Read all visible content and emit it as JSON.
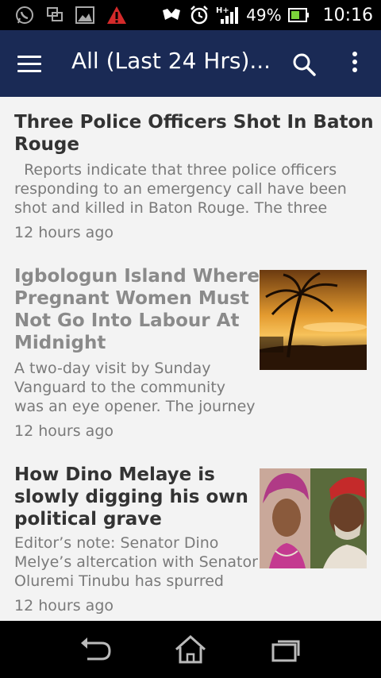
{
  "status_bar": {
    "battery": "49%",
    "time": "10:16",
    "icons": [
      "whatsapp-icon",
      "screenshot-icon",
      "gallery-icon",
      "warning-icon",
      "headset-icon",
      "alarm-icon",
      "hplus-signal-icon",
      "battery-icon"
    ]
  },
  "app_bar": {
    "title": "All (Last 24 Hrs)...",
    "color": "#1a2a55"
  },
  "articles": [
    {
      "title_line1": "Three Police Officers Shot In Baton",
      "title_line2": "Rouge",
      "summary_line1": "  Reports indicate that three police officers",
      "summary_line2": "responding to an emergency call have been",
      "summary_line3": "shot and killed in Baton Rouge. The three",
      "time": "12 hours ago",
      "read": false
    },
    {
      "title_line1": "Igbologun Island Where",
      "title_line2": "Pregnant Women Must",
      "title_line3": "Not Go Into Labour At",
      "title_line4": "Midnight",
      "summary_line1": "A two-day visit by Sunday",
      "summary_line2": "Vanguard to the community",
      "summary_line3": "was an eye opener. The journey",
      "time": "12 hours ago",
      "read": true,
      "image": "sunset-palm-photo"
    },
    {
      "title_line1": "How Dino Melaye is",
      "title_line2": "slowly digging his own",
      "title_line3": "political grave",
      "summary_line1": "Editor’s note: Senator Dino",
      "summary_line2": "Melye’s altercation with Senator",
      "summary_line3": "Oluremi Tinubu has spurred",
      "time": "12 hours ago",
      "read": false,
      "image": "two-people-photo"
    }
  ],
  "nav_bar": {
    "buttons": [
      "back-icon",
      "home-icon",
      "recent-apps-icon"
    ]
  }
}
